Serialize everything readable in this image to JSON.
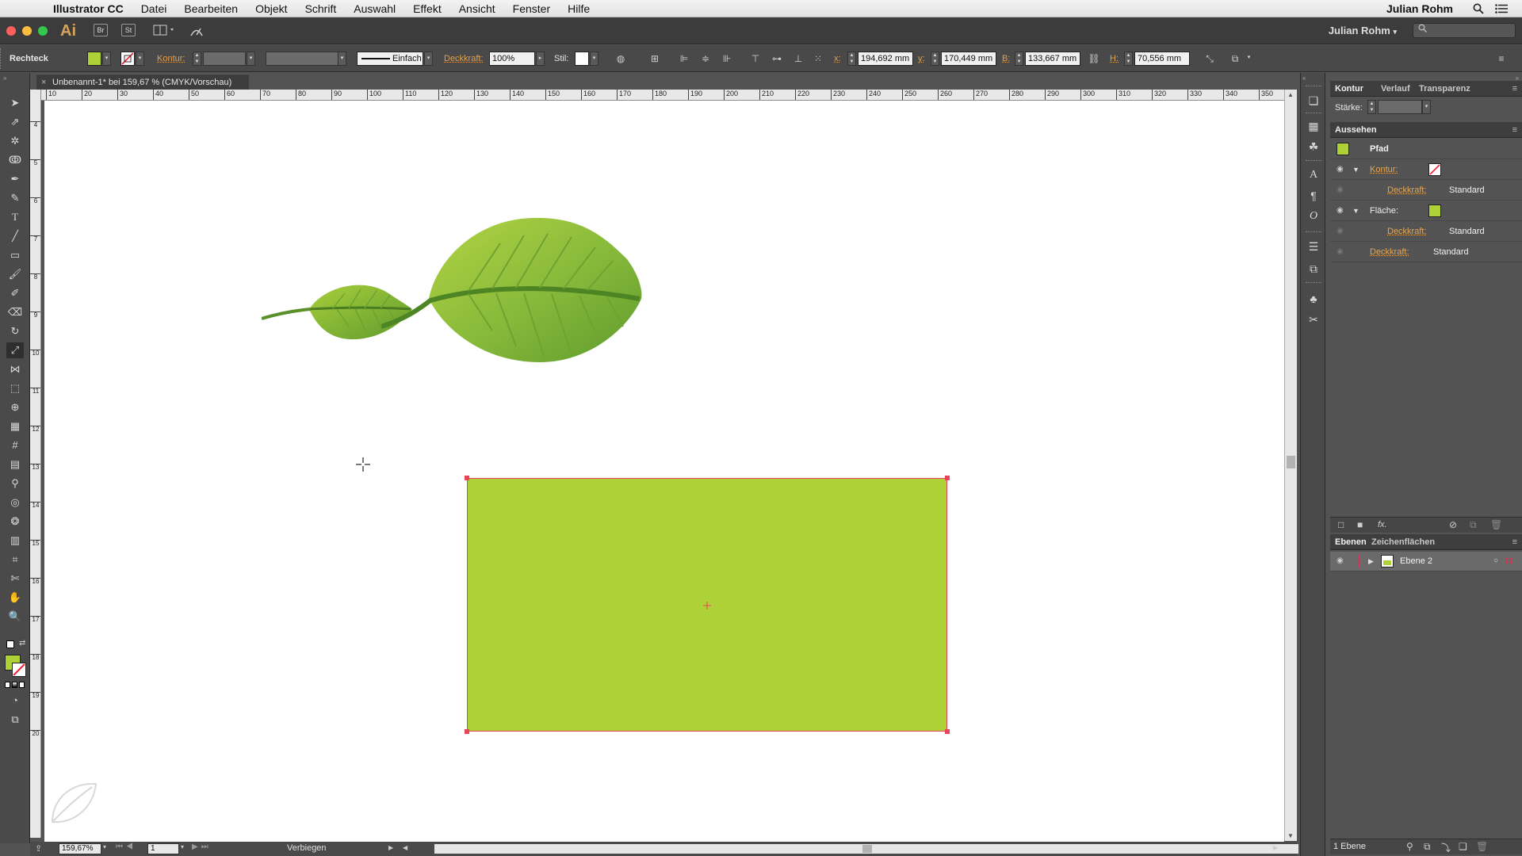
{
  "menubar": {
    "app": "Illustrator CC",
    "items": [
      "Datei",
      "Bearbeiten",
      "Objekt",
      "Schrift",
      "Auswahl",
      "Effekt",
      "Ansicht",
      "Fenster",
      "Hilfe"
    ],
    "user": "Julian Rohm"
  },
  "appbar": {
    "logo": "Ai",
    "bridge": "Br",
    "stock": "St",
    "user": "Julian Rohm"
  },
  "control": {
    "selection": "Rechteck",
    "kontur_label": "Kontur:",
    "stroke_style": "Einfach",
    "deckkraft_label": "Deckkraft:",
    "deckkraft_value": "100%",
    "stil_label": "Stil:",
    "x_label": "x:",
    "x_value": "194,692 mm",
    "y_label": "y:",
    "y_value": "170,449 mm",
    "b_label": "B:",
    "b_value": "133,667 mm",
    "h_label": "H:",
    "h_value": "70,556 mm"
  },
  "document": {
    "tab_title": "Unbenannt-1* bei 159,67 % (CMYK/Vorschau)",
    "close": "×"
  },
  "ruler": {
    "h_ticks": [
      "10",
      "20",
      "30",
      "40",
      "50",
      "60",
      "70",
      "80",
      "90",
      "100",
      "110",
      "120",
      "130",
      "140",
      "150",
      "160",
      "170",
      "180",
      "190",
      "200",
      "210",
      "220",
      "230",
      "240",
      "250",
      "260",
      "270",
      "280",
      "290",
      "300",
      "310",
      "320",
      "330",
      "340",
      "350"
    ],
    "v_ticks": [
      "4",
      "5",
      "6",
      "7",
      "8",
      "9",
      "10",
      "11",
      "12",
      "13",
      "14",
      "15",
      "16",
      "17",
      "18",
      "19",
      "20"
    ]
  },
  "status": {
    "zoom": "159,67%",
    "page": "1",
    "tool_name": "Verbiegen"
  },
  "panels": {
    "top_tabs": [
      "Kontur",
      "Verlauf",
      "Transparenz"
    ],
    "staerke_label": "Stärke:",
    "aussehen_title": "Aussehen",
    "object_type": "Pfad",
    "rows": [
      {
        "label": "Kontur:",
        "value": ""
      },
      {
        "label": "Deckkraft:",
        "value": "Standard"
      },
      {
        "label": "Fläche:",
        "value": ""
      },
      {
        "label": "Deckkraft:",
        "value": "Standard"
      },
      {
        "label": "Deckkraft:",
        "value": "Standard"
      }
    ],
    "fx_label": "fx.",
    "layer_tabs": [
      "Ebenen",
      "Zeichenflächen"
    ],
    "layer_name": "Ebene 2",
    "layer_count": "1 Ebene"
  },
  "colors": {
    "fill_green": "#add136",
    "selection_red": "#e8455a",
    "leaf_dark": "#5f9a2e",
    "leaf_light": "#a9cf3b",
    "orange_link": "#e7a652"
  }
}
